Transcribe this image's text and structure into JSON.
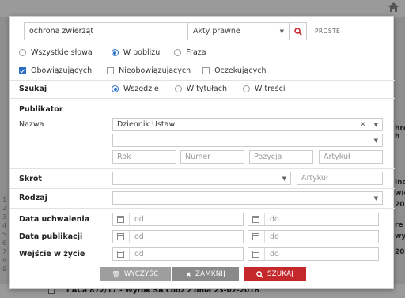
{
  "search": {
    "query": "ochrona zwierząt",
    "act_type": "Akty prawne",
    "mode_label": "PROSTE"
  },
  "match_mode": {
    "options": [
      "Wszystkie słowa",
      "W pobliżu",
      "Fraza"
    ],
    "selected": "W pobliżu"
  },
  "status": {
    "options": [
      {
        "label": "Obowiązujących",
        "checked": true
      },
      {
        "label": "Nieobowiązujących",
        "checked": false
      },
      {
        "label": "Oczekujących",
        "checked": false
      }
    ]
  },
  "scope": {
    "label": "Szukaj",
    "options": [
      "Wszędzie",
      "W tytułach",
      "W treści"
    ],
    "selected": "Wszędzie"
  },
  "publisher": {
    "section_label": "Publikator",
    "name_label": "Nazwa",
    "name_value": "Dziennik Ustaw",
    "second_value": "",
    "year_placeholder": "Rok",
    "number_placeholder": "Numer",
    "position_placeholder": "Pozycja",
    "article_placeholder": "Artykuł"
  },
  "shortcut": {
    "label": "Skrót",
    "value": "",
    "article_placeholder": "Artykuł"
  },
  "kind": {
    "label": "Rodzaj",
    "value": ""
  },
  "dates": [
    {
      "label": "Data uchwalenia",
      "from_placeholder": "od",
      "to_placeholder": "do"
    },
    {
      "label": "Data publikacji",
      "from_placeholder": "od",
      "to_placeholder": "do"
    },
    {
      "label": "Wejście w życie",
      "from_placeholder": "od",
      "to_placeholder": "do"
    }
  ],
  "buttons": {
    "clear": "WYCZYŚĆ",
    "close": "ZAMKNIJ",
    "search": "SZUKAJ"
  },
  "background": {
    "bottom_text": "I ACa 872/17 - Wyrok SA Łódź z dnia 23-02-2018",
    "right_fragments": [
      "hro",
      "h",
      "lno",
      "wie",
      "20",
      "re",
      "wy",
      "20"
    ],
    "left_numbers": [
      "1",
      "2",
      "3",
      "4",
      "5",
      "6",
      "7",
      "8",
      "9"
    ]
  },
  "colors": {
    "accent": "#2a6ec4",
    "search_button": "#c4282b",
    "overlay": "#8c8c8c"
  }
}
